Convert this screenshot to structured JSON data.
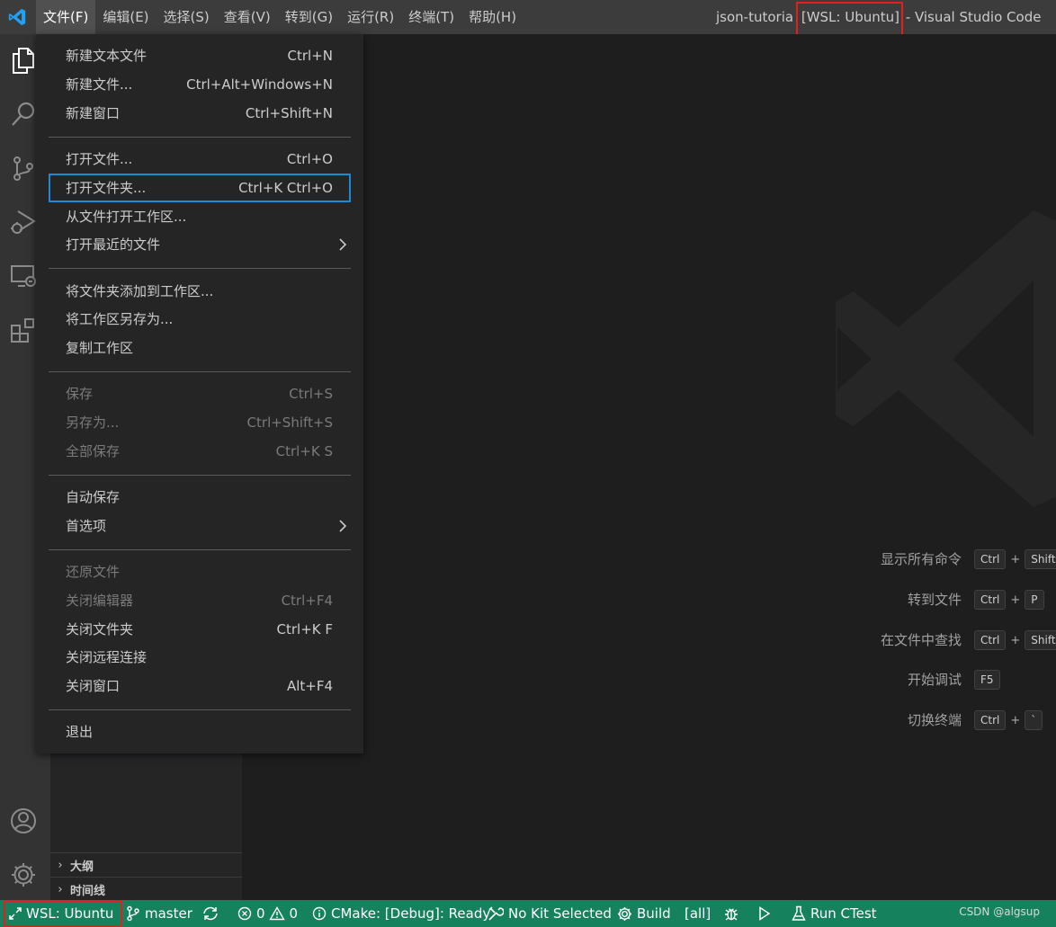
{
  "titlebar": {
    "menus": [
      "文件(F)",
      "编辑(E)",
      "选择(S)",
      "查看(V)",
      "转到(G)",
      "运行(R)",
      "终端(T)",
      "帮助(H)"
    ],
    "title_prefix": "json-tutoria",
    "title_remote": "[WSL: Ubuntu]",
    "title_suffix": "- Visual Studio Code"
  },
  "file_menu": {
    "items": [
      {
        "label": "新建文本文件",
        "shortcut": "Ctrl+N"
      },
      {
        "label": "新建文件...",
        "shortcut": "Ctrl+Alt+Windows+N"
      },
      {
        "label": "新建窗口",
        "shortcut": "Ctrl+Shift+N"
      },
      {
        "label": "打开文件...",
        "shortcut": "Ctrl+O"
      },
      {
        "label": "打开文件夹...",
        "shortcut": "Ctrl+K Ctrl+O"
      },
      {
        "label": "从文件打开工作区...",
        "shortcut": ""
      },
      {
        "label": "打开最近的文件",
        "shortcut": ""
      },
      {
        "label": "将文件夹添加到工作区...",
        "shortcut": ""
      },
      {
        "label": "将工作区另存为...",
        "shortcut": ""
      },
      {
        "label": "复制工作区",
        "shortcut": ""
      },
      {
        "label": "保存",
        "shortcut": "Ctrl+S"
      },
      {
        "label": "另存为...",
        "shortcut": "Ctrl+Shift+S"
      },
      {
        "label": "全部保存",
        "shortcut": "Ctrl+K S"
      },
      {
        "label": "自动保存",
        "shortcut": ""
      },
      {
        "label": "首选项",
        "shortcut": ""
      },
      {
        "label": "还原文件",
        "shortcut": ""
      },
      {
        "label": "关闭编辑器",
        "shortcut": "Ctrl+F4"
      },
      {
        "label": "关闭文件夹",
        "shortcut": "Ctrl+K F"
      },
      {
        "label": "关闭远程连接",
        "shortcut": ""
      },
      {
        "label": "关闭窗口",
        "shortcut": "Alt+F4"
      },
      {
        "label": "退出",
        "shortcut": ""
      }
    ]
  },
  "sidebar": {
    "sections": [
      "大纲",
      "时间线"
    ]
  },
  "editor": {
    "shortcuts": [
      {
        "label": "显示所有命令",
        "keys": [
          "Ctrl",
          "Shift"
        ]
      },
      {
        "label": "转到文件",
        "keys": [
          "Ctrl",
          "P"
        ]
      },
      {
        "label": "在文件中查找",
        "keys": [
          "Ctrl",
          "Shift"
        ]
      },
      {
        "label": "开始调试",
        "keys": [
          "F5"
        ]
      },
      {
        "label": "切换终端",
        "keys": [
          "Ctrl",
          "`"
        ]
      }
    ],
    "plus": "+"
  },
  "statusbar": {
    "remote": "WSL: Ubuntu",
    "branch": "master",
    "errors": "0",
    "warnings": "0",
    "cmake": "CMake: [Debug]: Ready",
    "kit": "No Kit Selected",
    "build": "Build",
    "target": "[all]",
    "ctest": "Run CTest",
    "credit": "CSDN @algsup"
  },
  "colors": {
    "statusbar": "#16825d",
    "highlight_box": "#e02020",
    "focus_outline": "#1c8ad6"
  }
}
